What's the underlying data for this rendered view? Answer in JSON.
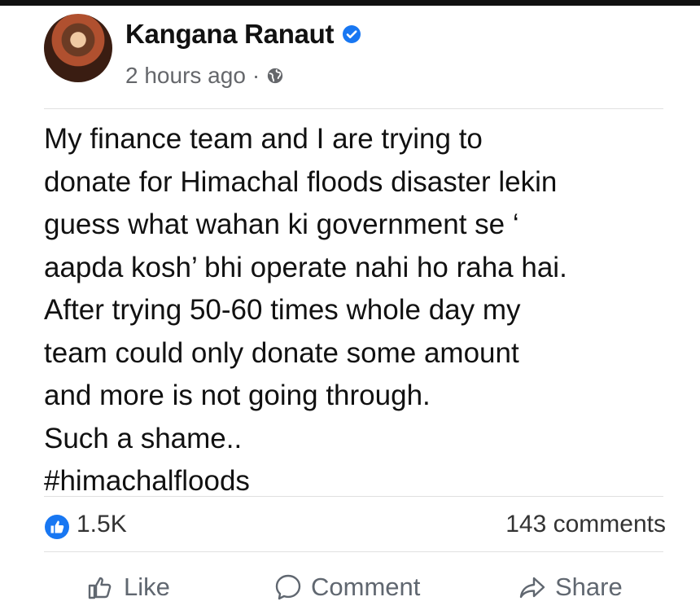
{
  "post": {
    "author": "Kangana Ranaut",
    "timestamp": "2 hours ago",
    "separator": "·",
    "privacy_icon": "globe-icon",
    "verified_icon": "verified-badge-icon",
    "body": "My finance team and I are trying to\ndonate for Himachal floods disaster lekin\nguess what wahan ki government se ‘\naapda kosh’ bhi operate nahi ho raha hai.\nAfter trying 50-60 times whole day my\nteam could only donate some amount\nand more is not going through.\nSuch a shame..\n#himachalfloods"
  },
  "stats": {
    "reactions": "1.5K",
    "comments": "143 comments"
  },
  "actions": {
    "like": "Like",
    "comment": "Comment",
    "share": "Share"
  },
  "colors": {
    "accent": "#1877f2",
    "muted": "#65676b"
  }
}
